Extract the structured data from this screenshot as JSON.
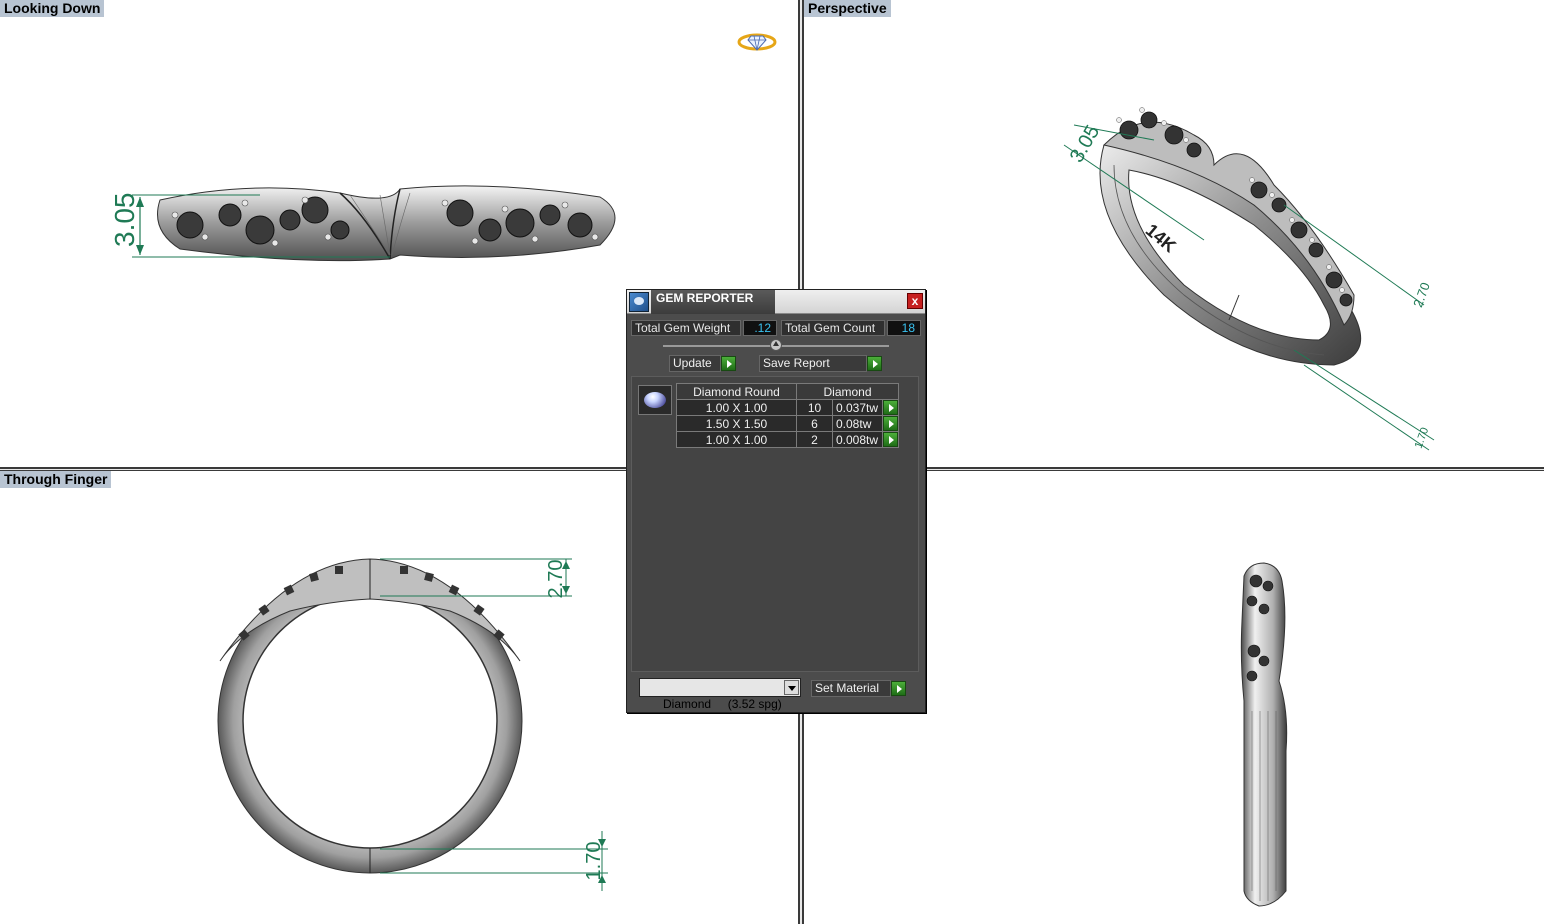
{
  "viewports": {
    "top_left": {
      "label": "Looking Down"
    },
    "top_right": {
      "label": "Perspective"
    },
    "bottom_left": {
      "label": "Through Finger"
    },
    "bottom_right": {
      "label": ""
    }
  },
  "dimensions": {
    "looking_down_height": "3.05",
    "perspective_height": "3.05",
    "perspective_right_a": "2.70",
    "perspective_right_b": "1.70",
    "through_finger_top": "2.70",
    "through_finger_bottom": "1.70"
  },
  "stamp": "14K",
  "gem_reporter": {
    "title": "GEM REPORTER",
    "close_label": "x",
    "total_weight_label": "Total Gem Weight",
    "total_weight_value": ".12",
    "total_count_label": "Total Gem Count",
    "total_count_value": "18",
    "update_label": "Update",
    "save_report_label": "Save Report",
    "table": {
      "headers": [
        "Diamond Round",
        "Diamond"
      ],
      "rows": [
        {
          "size": "1.00 X 1.00",
          "count": "10",
          "weight": "0.037tw"
        },
        {
          "size": "1.50 X 1.50",
          "count": "6",
          "weight": "0.08tw"
        },
        {
          "size": "1.00 X 1.00",
          "count": "2",
          "weight": "0.008tw"
        }
      ]
    },
    "material_select_value": "Diamond     (3.52 spg)",
    "set_material_label": "Set Material"
  },
  "colors": {
    "dimension": "#1f7a55",
    "viewport_label_bg": "#b8c4d2",
    "dialog_bg": "#4c4c4c",
    "value_text": "#39c2f0",
    "go_button": "#2f8f24",
    "close_button": "#c62020"
  }
}
